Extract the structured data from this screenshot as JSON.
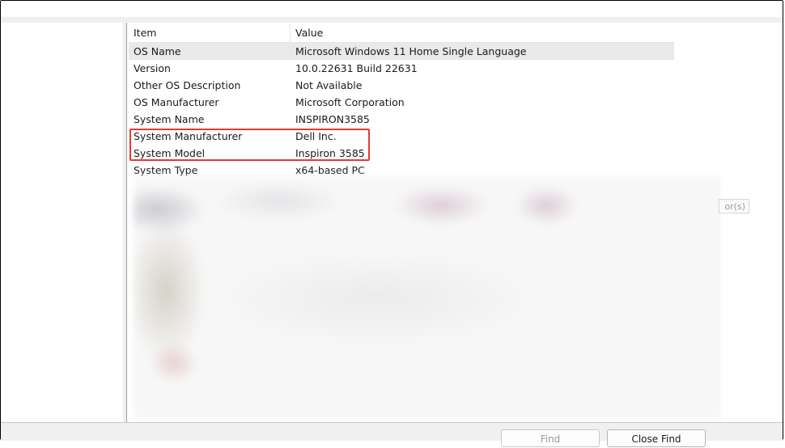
{
  "table": {
    "columns": {
      "item": "Item",
      "value": "Value"
    },
    "rows": [
      {
        "item": "OS Name",
        "value": "Microsoft Windows 11 Home Single Language"
      },
      {
        "item": "Version",
        "value": "10.0.22631 Build 22631"
      },
      {
        "item": "Other OS Description",
        "value": "Not Available"
      },
      {
        "item": "OS Manufacturer",
        "value": "Microsoft Corporation"
      },
      {
        "item": "System Name",
        "value": "INSPIRON3585"
      },
      {
        "item": "System Manufacturer",
        "value": "Dell Inc."
      },
      {
        "item": "System Model",
        "value": "Inspiron 3585"
      },
      {
        "item": "System Type",
        "value": "x64-based PC"
      }
    ],
    "selected_row": "OS Name",
    "highlighted_rows": [
      "System Manufacturer",
      "System Model"
    ],
    "highlight_color": "#e53935"
  },
  "truncated_text": "or(s)",
  "find_bar": {
    "find_label": "Find",
    "close_find_label": "Close Find"
  }
}
